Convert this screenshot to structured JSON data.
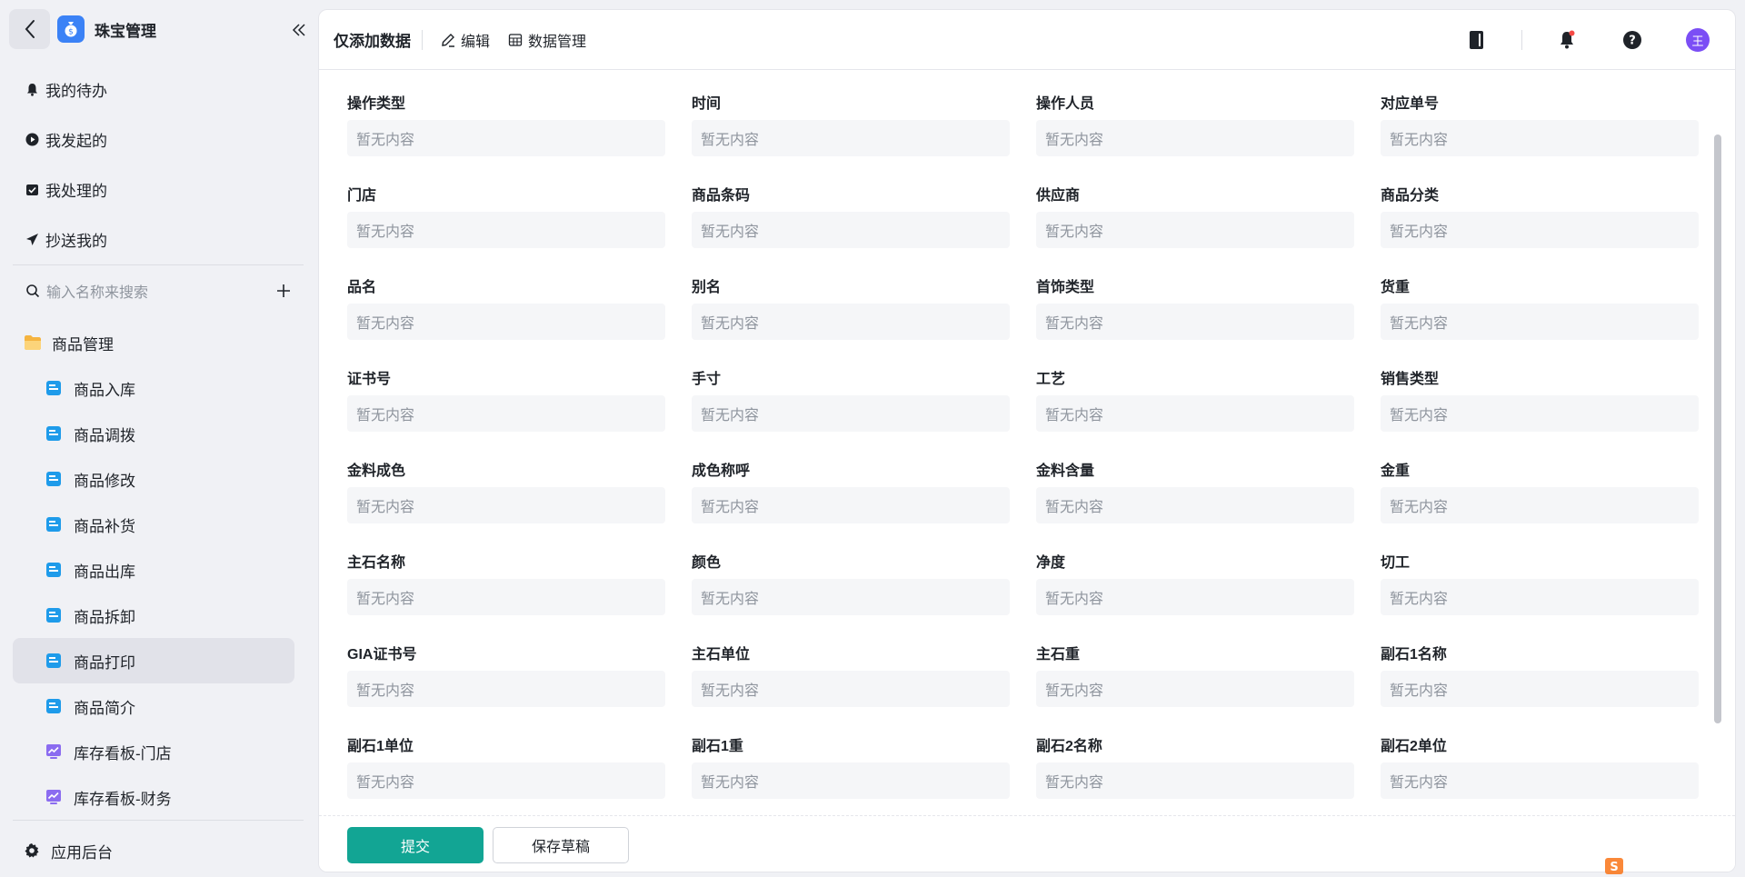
{
  "app": {
    "title": "珠宝管理"
  },
  "sidebar": {
    "nav": [
      {
        "label": "我的待办",
        "icon": "bell-icon"
      },
      {
        "label": "我发起的",
        "icon": "play-circle-icon"
      },
      {
        "label": "我处理的",
        "icon": "checkbox-icon"
      },
      {
        "label": "抄送我的",
        "icon": "send-icon"
      }
    ],
    "search_placeholder": "输入名称来搜索",
    "folder": {
      "label": "商品管理",
      "icon": "folder-icon"
    },
    "items": [
      {
        "label": "商品入库",
        "icon": "form-icon"
      },
      {
        "label": "商品调拨",
        "icon": "form-icon"
      },
      {
        "label": "商品修改",
        "icon": "form-icon"
      },
      {
        "label": "商品补货",
        "icon": "form-icon"
      },
      {
        "label": "商品出库",
        "icon": "form-icon"
      },
      {
        "label": "商品拆卸",
        "icon": "form-icon"
      },
      {
        "label": "商品打印",
        "icon": "form-icon",
        "active": true
      },
      {
        "label": "商品简介",
        "icon": "form-icon"
      },
      {
        "label": "库存看板-门店",
        "icon": "dashboard-icon"
      },
      {
        "label": "库存看板-财务",
        "icon": "dashboard-icon"
      }
    ],
    "bottom": {
      "label": "应用后台",
      "icon": "gear-icon"
    }
  },
  "topbar": {
    "view_title": "仅添加数据",
    "edit_label": "编辑",
    "data_manage_label": "数据管理",
    "avatar_text": "王"
  },
  "form": {
    "placeholder": "暂无内容",
    "fields": [
      "操作类型",
      "时间",
      "操作人员",
      "对应单号",
      "门店",
      "商品条码",
      "供应商",
      "商品分类",
      "品名",
      "别名",
      "首饰类型",
      "货重",
      "证书号",
      "手寸",
      "工艺",
      "销售类型",
      "金料成色",
      "成色称呼",
      "金料含量",
      "金重",
      "主石名称",
      "颜色",
      "净度",
      "切工",
      "GIA证书号",
      "主石单位",
      "主石重",
      "副石1名称",
      "副石1单位",
      "副石1重",
      "副石2名称",
      "副石2单位"
    ]
  },
  "actions": {
    "submit_label": "提交",
    "draft_label": "保存草稿"
  },
  "colors": {
    "accent": "#12a594",
    "avatar": "#7b4ef5",
    "app_logo": "#3b82f6",
    "form_icon": "#1e9bea",
    "dashboard_icon": "#8b6cf0",
    "folder_icon": "#f5b440"
  }
}
